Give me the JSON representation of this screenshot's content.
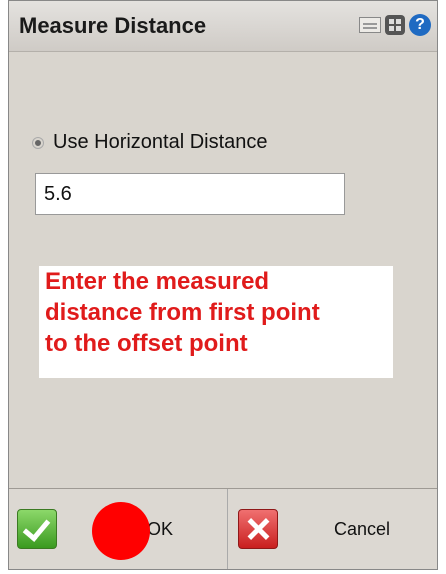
{
  "window": {
    "title": "Measure Distance"
  },
  "form": {
    "option_label": "Use Horizontal Distance",
    "distance_value": "5.6"
  },
  "annotation": {
    "line1": "Enter the measured",
    "line2": "distance from first point",
    "line3": "to the offset point"
  },
  "buttons": {
    "ok_label": "OK",
    "cancel_label": "Cancel"
  },
  "colors": {
    "annotation_text": "#e01b1b",
    "marker": "#ff0000",
    "help_icon": "#1f6ac2"
  }
}
